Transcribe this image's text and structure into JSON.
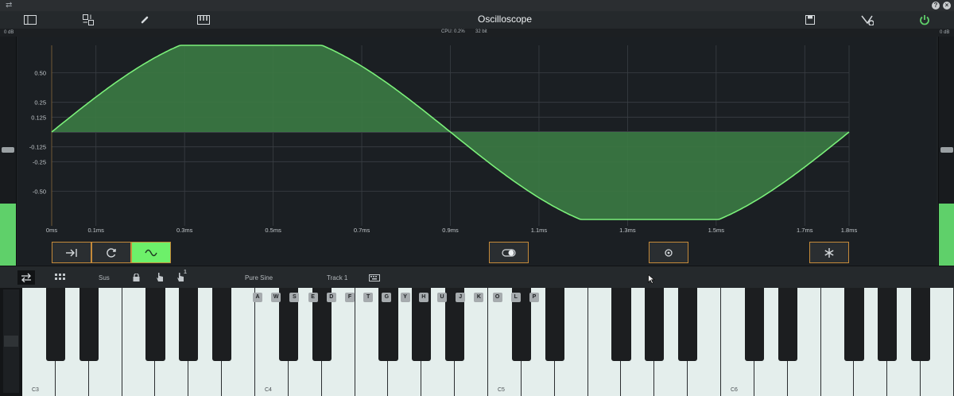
{
  "titlebar": {
    "help_label": "?",
    "close_label": "×"
  },
  "toolbar": {
    "title": "Oscilloscope"
  },
  "status": {
    "cpu": "CPU: 0.2%",
    "bits": "32 bit",
    "left_db": "0 dB",
    "right_db": "0 dB"
  },
  "meters": {
    "left_level": 0.27,
    "right_level": 0.27
  },
  "chart_data": {
    "type": "area",
    "ylabel": "",
    "xlabel": "",
    "y_ticks": [
      "0.50",
      "0.25",
      "0.125",
      "-0.125",
      "-0.25",
      "-0.50"
    ],
    "x_ticks": [
      "0ms",
      "0.1ms",
      "0.3ms",
      "0.5ms",
      "0.7ms",
      "0.9ms",
      "1.1ms",
      "1.3ms",
      "1.5ms",
      "1.7ms",
      "1.8ms"
    ],
    "waveform": "sine",
    "x_range_ms": [
      0,
      1.8
    ],
    "period_ms": 1.8,
    "grid": true,
    "fill_color": "#3b7a44",
    "line_color": "#7bf07a"
  },
  "scope_buttons": {
    "active": "sine-mode"
  },
  "keyboard_bar": {
    "sustain_label": "Sus",
    "preset": "Pure Sine",
    "track": "Track 1",
    "octave_badge": "1"
  },
  "keyboard": {
    "octave_labels": [
      "C3",
      "C4",
      "C5",
      "C6"
    ],
    "key_hints": [
      "A",
      "W",
      "S",
      "E",
      "D",
      "F",
      "T",
      "G",
      "Y",
      "H",
      "U",
      "J",
      "K",
      "O",
      "L",
      "P"
    ]
  },
  "colors": {
    "accent": "#5fd06a",
    "button_border": "#c58a3a"
  }
}
